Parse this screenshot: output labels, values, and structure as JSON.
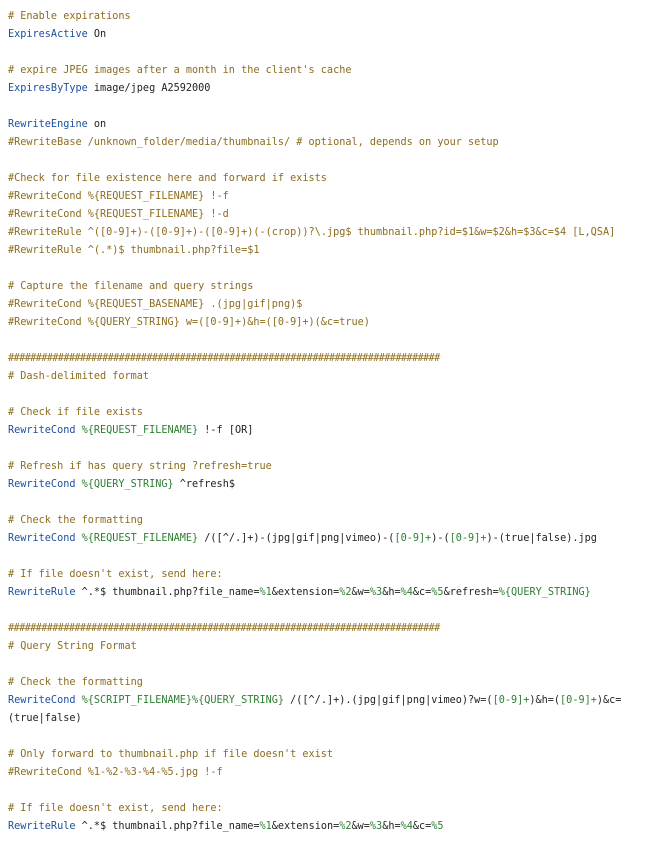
{
  "colors": {
    "background": "#ffffff",
    "comment": "#8c6d1f",
    "directive": "#1c4f9c",
    "variable": "#2f7d32",
    "text": "#222222"
  },
  "code": {
    "lines": [
      [
        {
          "t": "c",
          "v": "# Enable expirations"
        }
      ],
      [
        {
          "t": "kw",
          "v": "ExpiresActive"
        },
        {
          "t": "pl",
          "v": " On"
        }
      ],
      [],
      [
        {
          "t": "c",
          "v": "# expire JPEG images after a month in the client's cache"
        }
      ],
      [
        {
          "t": "kw",
          "v": "ExpiresByType"
        },
        {
          "t": "pl",
          "v": " image/jpeg A2592000"
        }
      ],
      [],
      [
        {
          "t": "kw",
          "v": "RewriteEngine"
        },
        {
          "t": "pl",
          "v": " on"
        }
      ],
      [
        {
          "t": "c",
          "v": "#RewriteBase /unknown_folder/media/thumbnails/ # optional, depends on your setup"
        }
      ],
      [],
      [
        {
          "t": "c",
          "v": "#Check for file existence here and forward if exists"
        }
      ],
      [
        {
          "t": "c",
          "v": "#RewriteCond %{REQUEST_FILENAME} !-f"
        }
      ],
      [
        {
          "t": "c",
          "v": "#RewriteCond %{REQUEST_FILENAME} !-d"
        }
      ],
      [
        {
          "t": "c",
          "v": "#RewriteRule ^([0-9]+)-([0-9]+)-([0-9]+)(-(crop))?\\.jpg$ thumbnail.php?id=$1&w=$2&h=$3&c=$4 [L,QSA]"
        }
      ],
      [
        {
          "t": "c",
          "v": "#RewriteRule ^(.*)$ thumbnail.php?file=$1"
        }
      ],
      [],
      [
        {
          "t": "c",
          "v": "# Capture the filename and query strings"
        }
      ],
      [
        {
          "t": "c",
          "v": "#RewriteCond %{REQUEST_BASENAME} .(jpg|gif|png)$"
        }
      ],
      [
        {
          "t": "c",
          "v": "#RewriteCond %{QUERY_STRING} w=([0-9]+)&h=([0-9]+)(&c=true)"
        }
      ],
      [],
      [
        {
          "t": "hash",
          "v": "##############################################################################"
        }
      ],
      [
        {
          "t": "c",
          "v": "# Dash-delimited format"
        }
      ],
      [],
      [
        {
          "t": "c",
          "v": "# Check if file exists"
        }
      ],
      [
        {
          "t": "kw",
          "v": "RewriteCond"
        },
        {
          "t": "pl",
          "v": " "
        },
        {
          "t": "var",
          "v": "%{REQUEST_FILENAME}"
        },
        {
          "t": "pl",
          "v": " !-f [OR]"
        }
      ],
      [],
      [
        {
          "t": "c",
          "v": "# Refresh if has query string ?refresh=true"
        }
      ],
      [
        {
          "t": "kw",
          "v": "RewriteCond"
        },
        {
          "t": "pl",
          "v": " "
        },
        {
          "t": "var",
          "v": "%{QUERY_STRING}"
        },
        {
          "t": "pl",
          "v": " ^refresh$"
        }
      ],
      [],
      [
        {
          "t": "c",
          "v": "# Check the formatting"
        }
      ],
      [
        {
          "t": "kw",
          "v": "RewriteCond"
        },
        {
          "t": "pl",
          "v": " "
        },
        {
          "t": "var",
          "v": "%{REQUEST_FILENAME}"
        },
        {
          "t": "pl",
          "v": " /([^/.]+)-(jpg|gif|png|vimeo)-("
        },
        {
          "t": "num",
          "v": "[0-9]+"
        },
        {
          "t": "pl",
          "v": ")-("
        },
        {
          "t": "num",
          "v": "[0-9]+"
        },
        {
          "t": "pl",
          "v": ")-(true|false).jpg"
        }
      ],
      [],
      [
        {
          "t": "c",
          "v": "# If file doesn't exist, send here:"
        }
      ],
      [
        {
          "t": "kw",
          "v": "RewriteRule"
        },
        {
          "t": "pl",
          "v": " ^.*$ thumbnail.php?file_name="
        },
        {
          "t": "var",
          "v": "%1"
        },
        {
          "t": "pl",
          "v": "&extension="
        },
        {
          "t": "var",
          "v": "%2"
        },
        {
          "t": "pl",
          "v": "&w="
        },
        {
          "t": "var",
          "v": "%3"
        },
        {
          "t": "pl",
          "v": "&h="
        },
        {
          "t": "var",
          "v": "%4"
        },
        {
          "t": "pl",
          "v": "&c="
        },
        {
          "t": "var",
          "v": "%5"
        },
        {
          "t": "pl",
          "v": "&refresh="
        },
        {
          "t": "var",
          "v": "%{QUERY_STRING}"
        }
      ],
      [],
      [
        {
          "t": "hash",
          "v": "##############################################################################"
        }
      ],
      [
        {
          "t": "c",
          "v": "# Query String Format"
        }
      ],
      [],
      [
        {
          "t": "c",
          "v": "# Check the formatting"
        }
      ],
      [
        {
          "t": "kw",
          "v": "RewriteCond"
        },
        {
          "t": "pl",
          "v": " "
        },
        {
          "t": "var",
          "v": "%{SCRIPT_FILENAME}%{QUERY_STRING}"
        },
        {
          "t": "pl",
          "v": " /([^/.]+).(jpg|gif|png|vimeo)?w=("
        },
        {
          "t": "num",
          "v": "[0-9]+"
        },
        {
          "t": "pl",
          "v": ")&h=("
        },
        {
          "t": "num",
          "v": "[0-9]+"
        },
        {
          "t": "pl",
          "v": ")&c="
        }
      ],
      [
        {
          "t": "pl",
          "v": "(true|false)"
        }
      ],
      [],
      [
        {
          "t": "c",
          "v": "# Only forward to thumbnail.php if file doesn't exist"
        }
      ],
      [
        {
          "t": "c",
          "v": "#RewriteCond %1-%2-%3-%4-%5.jpg !-f"
        }
      ],
      [],
      [
        {
          "t": "c",
          "v": "# If file doesn't exist, send here:"
        }
      ],
      [
        {
          "t": "kw",
          "v": "RewriteRule"
        },
        {
          "t": "pl",
          "v": " ^.*$ thumbnail.php?file_name="
        },
        {
          "t": "var",
          "v": "%1"
        },
        {
          "t": "pl",
          "v": "&extension="
        },
        {
          "t": "var",
          "v": "%2"
        },
        {
          "t": "pl",
          "v": "&w="
        },
        {
          "t": "var",
          "v": "%3"
        },
        {
          "t": "pl",
          "v": "&h="
        },
        {
          "t": "var",
          "v": "%4"
        },
        {
          "t": "pl",
          "v": "&c="
        },
        {
          "t": "var",
          "v": "%5"
        }
      ]
    ]
  }
}
